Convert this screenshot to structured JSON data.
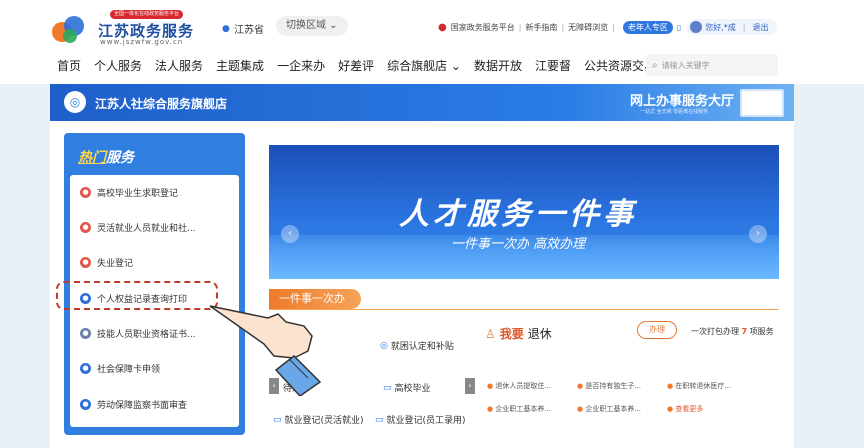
{
  "header": {
    "badge": "全国一体化在线政务服务平台",
    "title": "江苏政务服务",
    "domain": "www.jszwfw.gov.cn",
    "province": "江苏省",
    "switch_region": "切换区域",
    "top_links": [
      "国家政务服务平台",
      "新手指南",
      "无障碍浏览"
    ],
    "elder": "老年人专区",
    "greeting": "您好,*成",
    "logout": "退出"
  },
  "nav": {
    "items": [
      "首页",
      "个人服务",
      "法人服务",
      "主题集成",
      "一企来办",
      "好差评",
      "综合旗舰店 ⌄",
      "数据开放",
      "江要督",
      "公共资源交易"
    ],
    "search_placeholder": "请输入关键字"
  },
  "store_bar": {
    "title": "江苏人社综合服务旗舰店",
    "hall": "网上办事服务大厅",
    "hall_sub": "一站式 全天候 零距离在线服务"
  },
  "hot": {
    "title_hot": "热门",
    "title_rest": "服务",
    "items": [
      {
        "label": "高校毕业生求职登记",
        "color": "#e2574c"
      },
      {
        "label": "灵活就业人员就业和社...",
        "color": "#e2574c"
      },
      {
        "label": "失业登记",
        "color": "#e2574c"
      },
      {
        "label": "个人权益记录查询打印",
        "color": "#2f6fd8"
      },
      {
        "label": "技能人员职业资格证书...",
        "color": "#6a7fa8"
      },
      {
        "label": "社会保障卡申领",
        "color": "#2f6fd8"
      },
      {
        "label": "劳动保障监察书面审查",
        "color": "#2f6fd8"
      }
    ]
  },
  "banner": {
    "title": "人才服务一件事",
    "subtitle": "一件事一次办 高效办理"
  },
  "one_thing": {
    "tag": "一件事一次办",
    "cells": [
      "就困认定和补贴",
      "待遇",
      "高校毕业",
      "就业登记(灵活就业)",
      "就业登记(员工录用)"
    ],
    "retire_prefix": "我要",
    "retire_title": "退休",
    "banli": "办理",
    "pack_text": "一次打包办理",
    "pack_count": "7",
    "pack_unit": "项服务",
    "subs": [
      "退休人员提取住...",
      "是否持有独生子...",
      "在职转退休医疗...",
      "企业职工基本养...",
      "企业职工基本养..."
    ],
    "more": "查看更多"
  }
}
